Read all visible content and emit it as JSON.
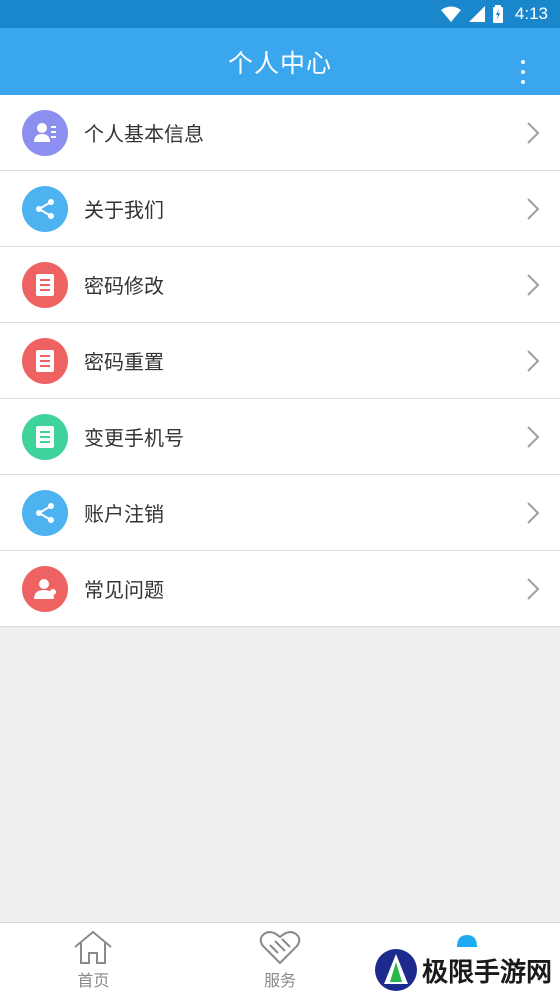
{
  "status_bar": {
    "time": "4:13",
    "icons": [
      "wifi-icon",
      "signal-icon",
      "battery-icon"
    ]
  },
  "app_bar": {
    "title": "个人中心",
    "menu_icon": "more-vertical-icon"
  },
  "menu_items": [
    {
      "label": "个人基本信息",
      "icon": "profile-card-icon",
      "color": "#8c8ef0"
    },
    {
      "label": "关于我们",
      "icon": "share-icon",
      "color": "#4db3f0"
    },
    {
      "label": "密码修改",
      "icon": "document-icon",
      "color": "#ef6262"
    },
    {
      "label": "密码重置",
      "icon": "document-icon",
      "color": "#ef6262"
    },
    {
      "label": "变更手机号",
      "icon": "document-icon",
      "color": "#3fd29b"
    },
    {
      "label": "账户注销",
      "icon": "share-icon",
      "color": "#4db3f0"
    },
    {
      "label": "常见问题",
      "icon": "user-group-icon",
      "color": "#ef6262"
    }
  ],
  "tabbar": {
    "tabs": [
      {
        "label": "首页",
        "icon": "home-icon"
      },
      {
        "label": "服务",
        "icon": "handshake-icon"
      },
      {
        "label": "",
        "icon": "profile-icon"
      }
    ]
  },
  "watermark": {
    "text": "极限手游网"
  },
  "colors": {
    "status_bar": "#1a86cc",
    "app_bar": "#3aa6ee",
    "background": "#efefef"
  }
}
